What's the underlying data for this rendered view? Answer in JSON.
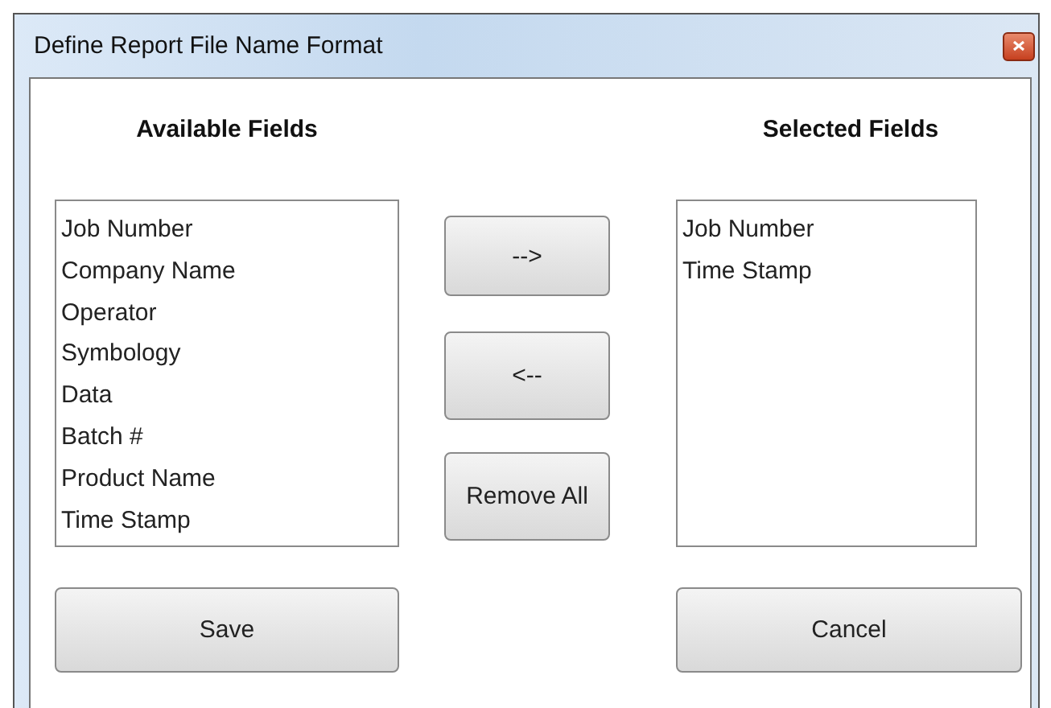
{
  "window": {
    "title": "Define Report File Name Format"
  },
  "available": {
    "heading": "Available Fields",
    "items": [
      {
        "label": "Job Number"
      },
      {
        "label": "Company Name"
      },
      {
        "label": "Operator"
      },
      {
        "label": "Symbology"
      },
      {
        "label": "Data"
      },
      {
        "label": "Batch #"
      },
      {
        "label": "Product Name"
      },
      {
        "label": "Time Stamp"
      }
    ]
  },
  "move_buttons": [
    {
      "label": "-->"
    },
    {
      "label": "<--"
    },
    {
      "label": "Remove All"
    }
  ],
  "selected": {
    "heading": "Selected Fields",
    "items": [
      {
        "label": "Job Number"
      },
      {
        "label": "Time Stamp"
      }
    ]
  },
  "buttons": [
    {
      "label": "Save"
    },
    {
      "label": "Cancel"
    }
  ]
}
